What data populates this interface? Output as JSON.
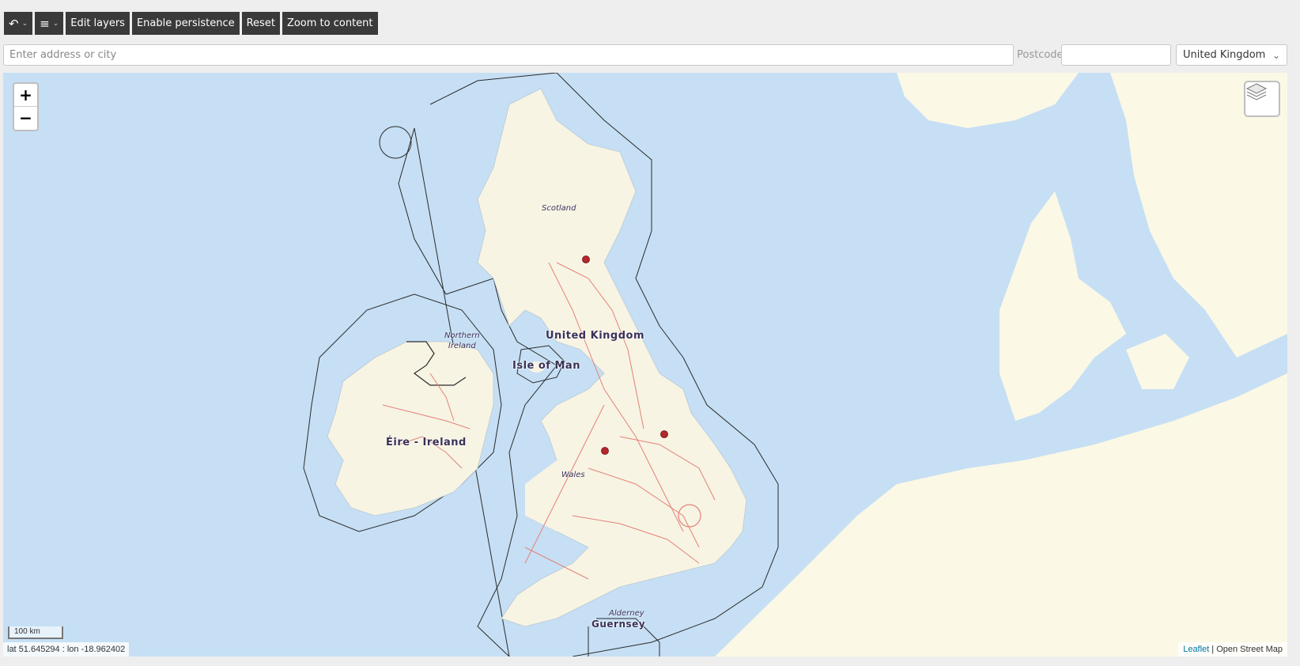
{
  "toolbar": {
    "undo_icon": "undo-icon",
    "menu_icon": "hamburger-menu-icon",
    "edit_layers": "Edit layers",
    "enable_persistence": "Enable persistence",
    "reset": "Reset",
    "zoom_to_content": "Zoom to content"
  },
  "search": {
    "address_placeholder": "Enter address or city",
    "postcode_label": "Postcode",
    "postcode_value": "",
    "country_selected": "United Kingdom"
  },
  "map": {
    "zoom_in": "+",
    "zoom_out": "−",
    "layers_icon": "layers-icon",
    "scale": "100 km",
    "coordinates": "lat 51.645294 : lon -18.962402",
    "attribution_leaflet": "Leaflet",
    "attribution_sep": " | ",
    "attribution_osm": "Open Street Map",
    "labels": {
      "scotland": "Scotland",
      "northern_ireland_1": "Northern",
      "northern_ireland_2": "Ireland",
      "united_kingdom": "United Kingdom",
      "isle_of_man": "Isle of Man",
      "eire": "Éire - Ireland",
      "wales": "Wales",
      "alderney": "Alderney",
      "guernsey": "Guernsey"
    },
    "colors": {
      "sea": "#c6dff4",
      "land": "#f7f4e3",
      "continent": "#fbf8e6",
      "roads": "#e4827a",
      "marker": "#b3262b"
    },
    "marker_count": 3
  }
}
